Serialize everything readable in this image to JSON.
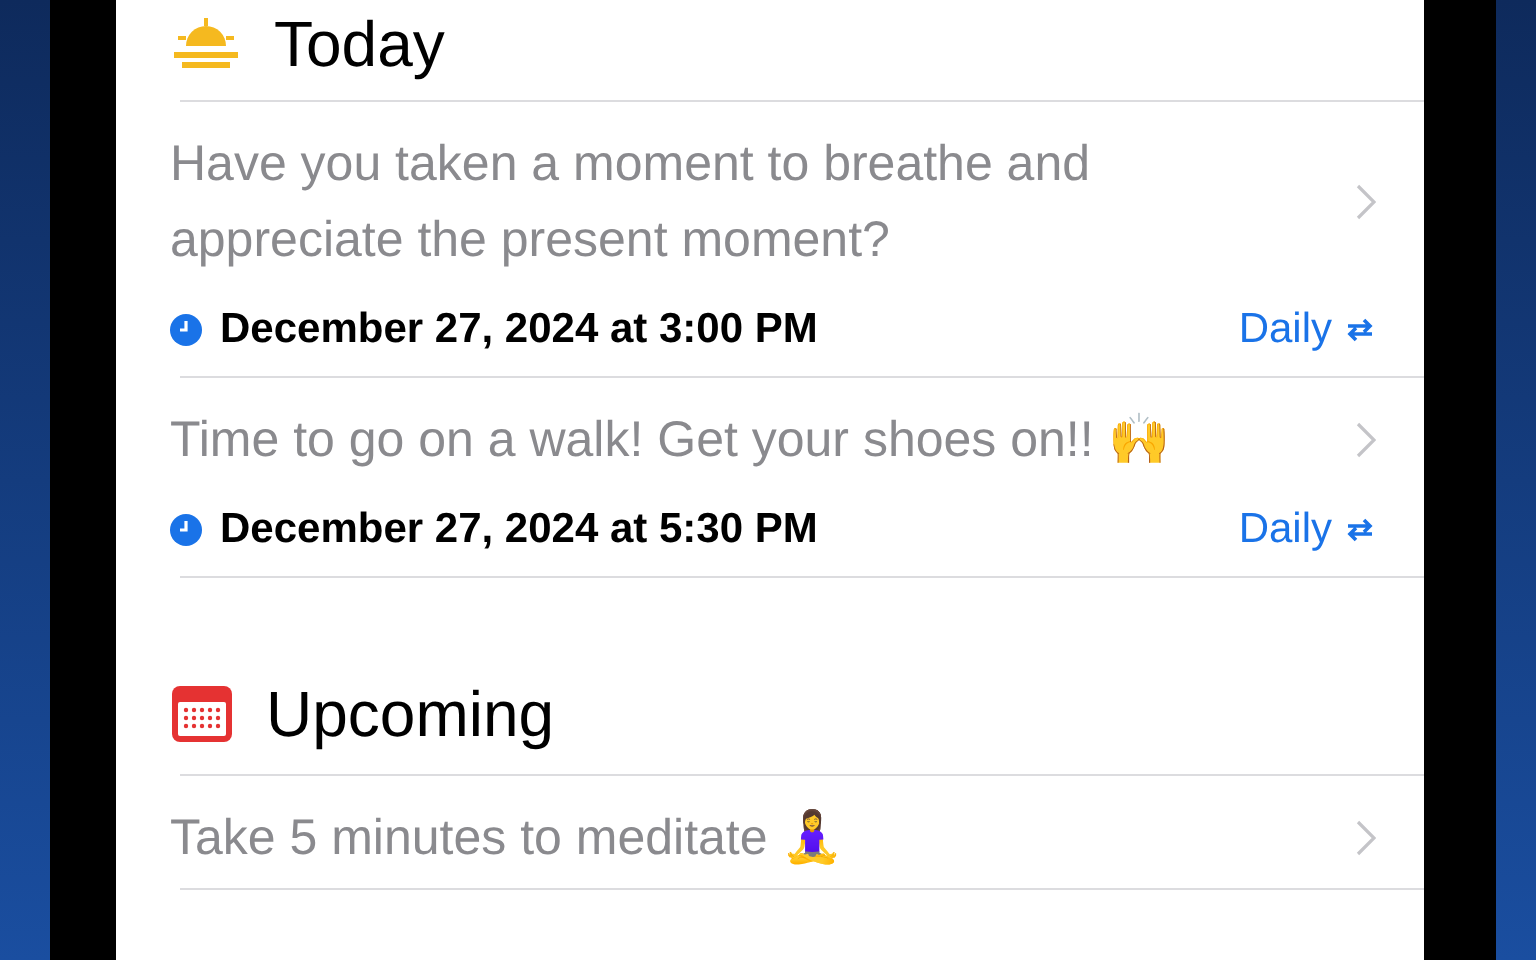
{
  "sections": [
    {
      "title": "Today",
      "reminders": [
        {
          "text": "Have you taken a moment to breathe and appreciate the present moment?",
          "date": "December 27, 2024 at 3:00 PM",
          "repeat": "Daily"
        },
        {
          "text": "Time to go on a walk! Get your shoes on!! 🙌",
          "date": "December 27, 2024 at 5:30 PM",
          "repeat": "Daily"
        }
      ]
    },
    {
      "title": "Upcoming",
      "reminders": [
        {
          "text": "Take 5 minutes to meditate 🧘‍♀️"
        }
      ]
    }
  ]
}
